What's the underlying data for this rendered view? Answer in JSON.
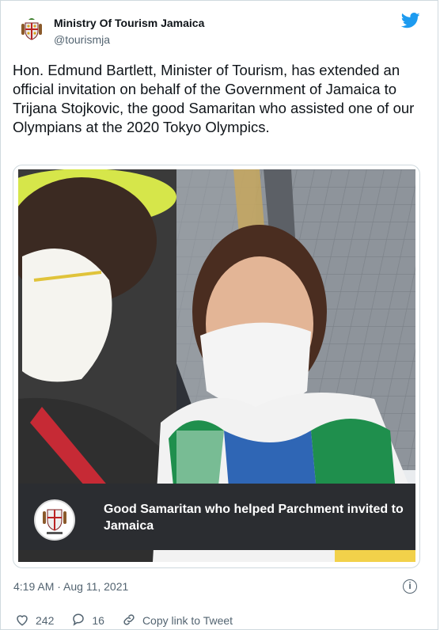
{
  "author": {
    "name": "Ministry Of Tourism Jamaica",
    "handle": "@tourismja"
  },
  "tweet": {
    "text": "Hon. Edmund Bartlett, Minister of Tourism, has extended an official invitation on behalf of the Government of Jamaica to Trijana  Stojkovic, the good Samaritan who assisted one of our Olympians at the 2020 Tokyo Olympics.",
    "timestamp": "4:19 AM · Aug 11, 2021"
  },
  "media": {
    "caption": "Good Samaritan who helped Parchment invited to Jamaica"
  },
  "actions": {
    "likes": "242",
    "replies": "16",
    "copy_link": "Copy link to Tweet"
  },
  "icons": {
    "brand": "twitter-bird-icon",
    "like": "heart-icon",
    "reply": "comment-icon",
    "link": "link-icon",
    "info": "info-icon"
  },
  "colors": {
    "twitter_blue": "#1d9bf0",
    "text": "#0f1419",
    "muted": "#536471",
    "banner": "#2b2d31"
  }
}
